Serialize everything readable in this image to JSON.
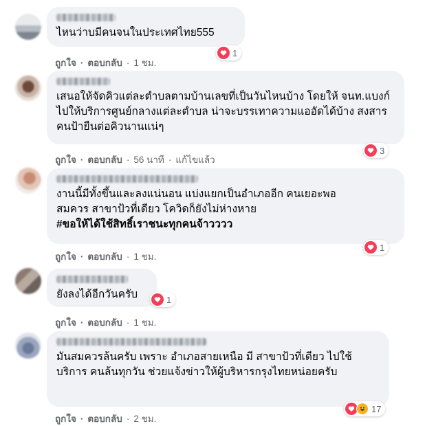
{
  "labels": {
    "like": "ถูกใจ",
    "reply": "ตอบกลับ",
    "sep": "·"
  },
  "colors": {
    "bubble": "#f0f2f5",
    "meta": "#65676b",
    "love": "#f33e58",
    "haha": "#f7b125"
  },
  "comments": [
    {
      "text": "ไหนว่าบมีคนจนในประเทศไทย555",
      "reactions": [
        "love"
      ],
      "reaction_count": "1",
      "time": "1 ชม.",
      "edited": ""
    },
    {
      "text": "เสนอให้จัดคิวแต่ละตำบลตามบ้านเลขที่เป็นวันไหนบ้าง โดยให้ จนท.แบงก์ไปให้บริการศูนย์กลางแต่ละตำบล น่าจะบรรเทาความแออัดได้บ้าง สงสารคนป้ายืนต่อคิวนานแน่ๆ",
      "reactions": [
        "love"
      ],
      "reaction_count": "3",
      "time": "56 นาที",
      "edited": "แก้ไขแล้ว"
    },
    {
      "text_lines": [
        "งานนี้มีทั้งขึ้นและลงแน่นอน แบ่งแยกเป็นอำเภออีก คนเยอะพอ",
        "สมควร สาขาป้วที่เดียว โควิดก็ยังไม่ห่างหาย"
      ],
      "hashtag": "#ขอให้ได้ใช้สิทธิ์เราชนะทุกคนจ้าวววว",
      "reactions": [
        "love"
      ],
      "reaction_count": "1",
      "time": "1 ชม.",
      "edited": ""
    },
    {
      "text": "ยังลงได้อีกวันครับ",
      "reactions": [
        "love"
      ],
      "reaction_count": "1",
      "time": "1 ชม.",
      "edited": ""
    },
    {
      "text": "มันสมควรล้นครับ เพราะ อำเภอสายเหนือ มี สาขาป้วที่เดียว ไปใช้บริการ คนล้นทุกวัน ช่วยแจ้งข่าวให้ผู้บริหารกรุงไทยหน่อยครับ",
      "reactions": [
        "love",
        "haha"
      ],
      "reaction_count": "17",
      "time": "2 ชม.",
      "edited": ""
    }
  ]
}
